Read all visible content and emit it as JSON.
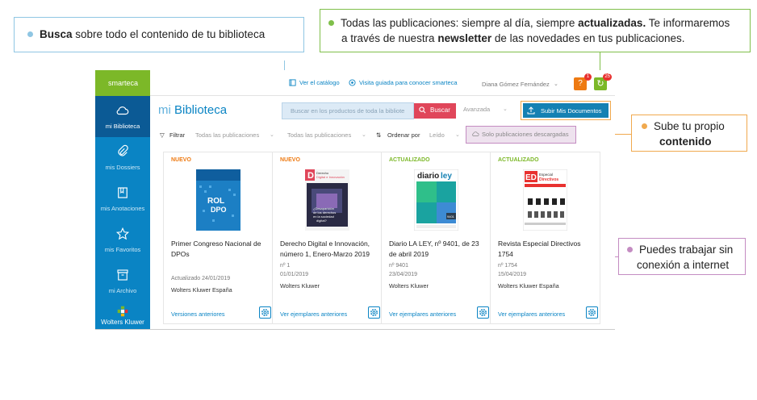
{
  "callouts": {
    "search": {
      "bold": "Busca",
      "rest": " sobre todo el contenido de tu biblioteca"
    },
    "news": {
      "line1_pre": "Todas las publicaciones: siempre al día, siempre ",
      "line1_bold": "actualizadas.",
      "line1_post": " Te informaremos",
      "line2_pre": "a través de nuestra ",
      "line2_bold": "newsletter",
      "line2_post": " de las novedades en tus publicaciones."
    },
    "upload": {
      "line1": "Sube tu propio",
      "line2_bold": "contenido"
    },
    "offline": {
      "line1": "Puedes trabajar sin",
      "line2": "conexión a internet"
    }
  },
  "colors": {
    "blue": "#0a84c4",
    "green": "#7cb828",
    "orange": "#f0a94e",
    "purple": "#c48cc2",
    "red": "#e0465a"
  },
  "sidebar": {
    "brand": "smarteca",
    "items": [
      {
        "label": "mi Biblioteca",
        "icon": "cloud-icon",
        "active": true
      },
      {
        "label": "mis Dossiers",
        "icon": "paperclip-icon"
      },
      {
        "label": "mis Anotaciones",
        "icon": "bookmark-icon"
      },
      {
        "label": "mis Favoritos",
        "icon": "star-icon"
      },
      {
        "label": "mi Archivo",
        "icon": "archive-icon"
      }
    ],
    "footer": "Wolters Kluwer"
  },
  "topbar": {
    "catalog": "Ver el catálogo",
    "tour": "Visita guiada para conocer smarteca",
    "user": "Diana Gómez Fernández",
    "help_badge": "1",
    "sync_badge": "25"
  },
  "header": {
    "title_prefix": "mi",
    "title": "Biblioteca",
    "search_placeholder": "Buscar en los productos de toda la bibliote",
    "search_button": "Buscar",
    "advanced": "Avanzada",
    "upload": "Subir Mis Documentos"
  },
  "filters": {
    "filter_label": "Filtrar",
    "all1": "Todas las publicaciones",
    "all2": "Todas las publicaciones",
    "order_label": "Ordenar por",
    "order_value": "Leído",
    "offline": "Solo publicaciones descargadas"
  },
  "cards": [
    {
      "status": "NUEVO",
      "status_color": "#ee7a12",
      "title": "Primer Congreso Nacional de DPOs",
      "meta": [
        "Actualizado 24/01/2019"
      ],
      "publisher": "Wolters Kluwer España",
      "link": "Versiones anteriores",
      "cover_text": "ROL DPO"
    },
    {
      "status": "NUEVO",
      "status_color": "#ee7a12",
      "title": "Derecho Digital e Innovación, número 1, Enero-Marzo 2019",
      "meta": [
        "nº 1",
        "01/01/2019"
      ],
      "publisher": "Wolters Kluwer",
      "link": "Ver ejemplares anteriores",
      "cover_text": "Derecho Digital e Innovación"
    },
    {
      "status": "ACTUALIZADO",
      "status_color": "#7cb828",
      "title": "Diario LA LEY, nº 9401, de 23 de abril 2019",
      "meta": [
        "nº 9401",
        "23/04/2019"
      ],
      "publisher": "Wolters Kluwer",
      "link": "Ver ejemplares anteriores",
      "cover_text": "diariolaley"
    },
    {
      "status": "ACTUALIZADO",
      "status_color": "#7cb828",
      "title": "Revista Especial Directivos 1754",
      "meta": [
        "nº 1754",
        "15/04/2019"
      ],
      "publisher": "Wolters Kluwer España",
      "link": "Ver ejemplares anteriores",
      "cover_text": "Especial Directivos"
    }
  ]
}
